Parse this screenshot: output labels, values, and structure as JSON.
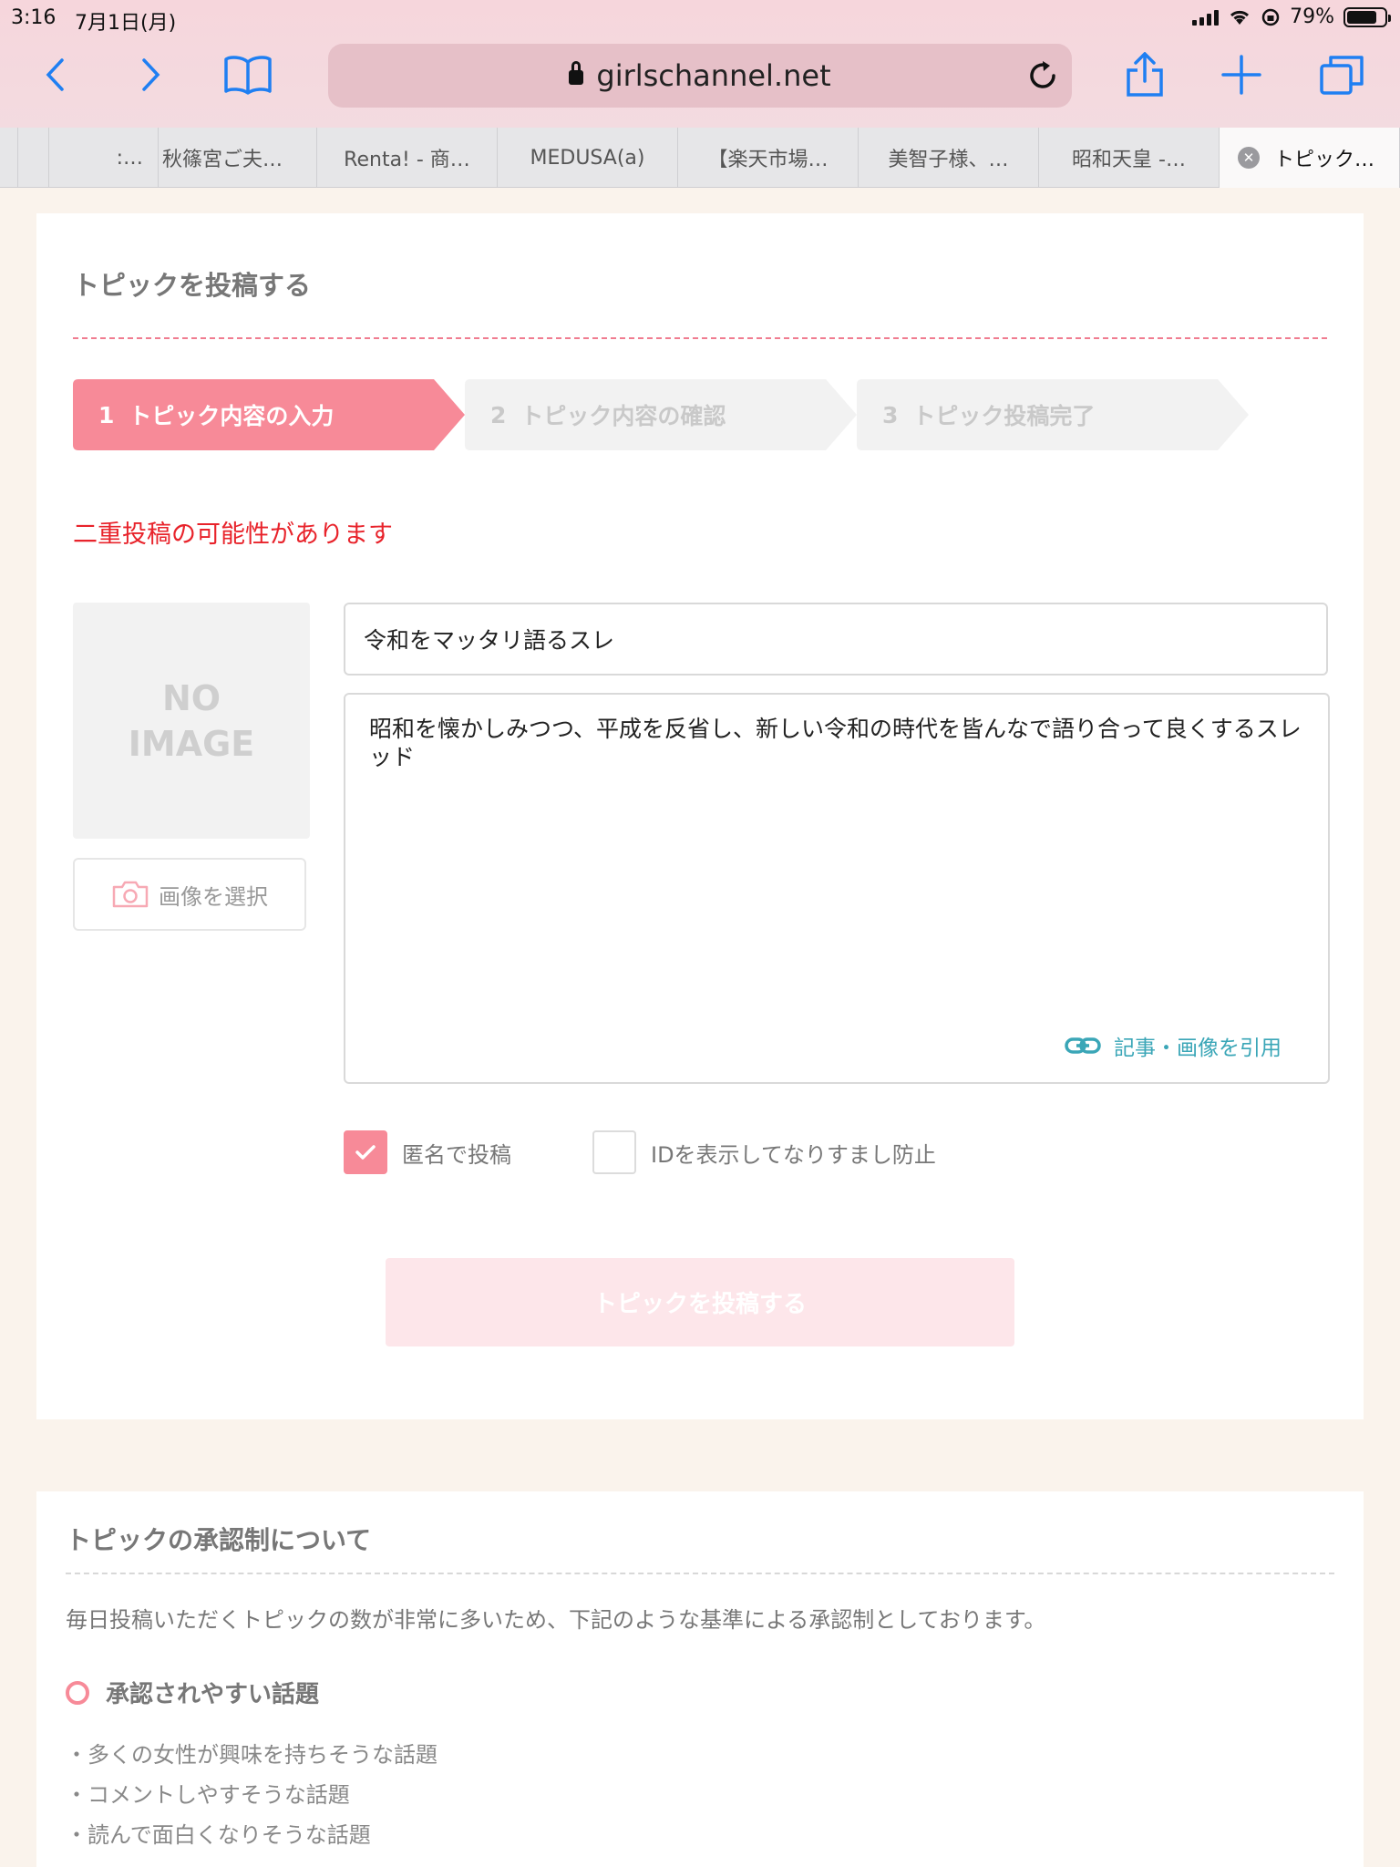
{
  "status": {
    "time": "3:16",
    "date": "7月1日(月)",
    "battery": "79%"
  },
  "browser": {
    "url": "girlschannel.net",
    "tabs": [
      {
        "title": "",
        "active": false
      },
      {
        "title": "",
        "active": false
      },
      {
        "title": ":…",
        "active": false
      },
      {
        "title": "秋篠宮ご夫…",
        "active": false
      },
      {
        "title": "Renta! - 商…",
        "active": false
      },
      {
        "title": "MEDUSA(a)",
        "active": false
      },
      {
        "title": "【楽天市場…",
        "active": false
      },
      {
        "title": "美智子様、…",
        "active": false
      },
      {
        "title": "昭和天皇 -…",
        "active": false
      },
      {
        "title": "トピック…",
        "active": true
      }
    ]
  },
  "form": {
    "heading": "トピックを投稿する",
    "steps": [
      {
        "num": "1",
        "label": "トピック内容の入力",
        "active": true
      },
      {
        "num": "2",
        "label": "トピック内容の確認",
        "active": false
      },
      {
        "num": "3",
        "label": "トピック投稿完了",
        "active": false
      }
    ],
    "warning": "二重投稿の可能性があります",
    "no_image_line1": "NO",
    "no_image_line2": "IMAGE",
    "select_image": "画像を選択",
    "title_value": "令和をマッタリ語るスレ",
    "body_value": "昭和を懐かしみつつ、平成を反省し、新しい令和の時代を皆んなで語り合って良くするスレッド",
    "quote_link": "記事・画像を引用",
    "anon_label": "匿名で投稿",
    "anon_checked": true,
    "id_label": "IDを表示してなりすまし防止",
    "id_checked": false,
    "submit": "トピックを投稿する"
  },
  "about": {
    "heading": "トピックの承認制について",
    "description": "毎日投稿いただくトピックの数が非常に多いため、下記のような基準による承認制としております。",
    "subheading": "承認されやすい話題",
    "items": [
      "・多くの女性が興味を持ちそうな話題",
      "・コメントしやすそうな話題",
      "・読んで面白くなりそうな話題"
    ]
  },
  "colors": {
    "accent": "#f78a98",
    "warning": "#e8232b",
    "link": "#3aa6b7",
    "ios_blue": "#1f7ff2"
  }
}
